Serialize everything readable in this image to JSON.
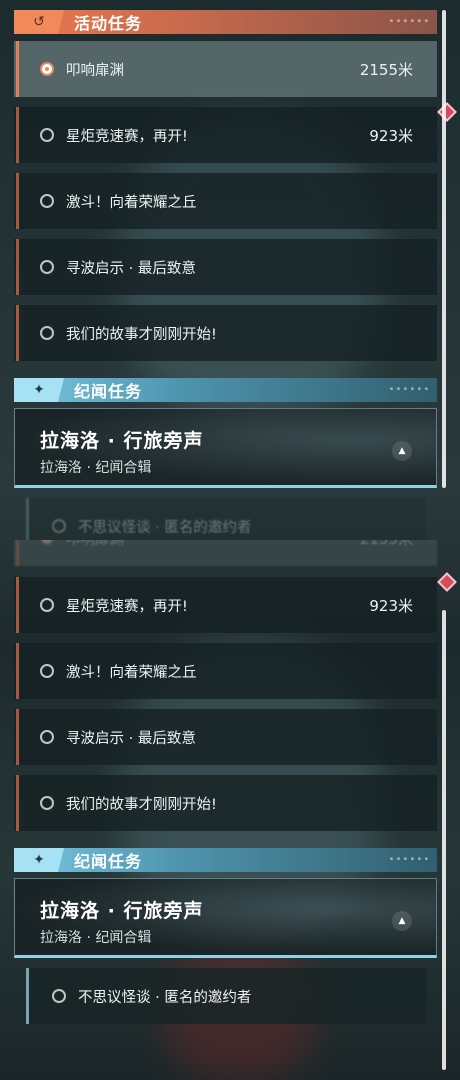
{
  "active_section": {
    "title": "活动任务",
    "badge_icon": "refresh-arrow-icon",
    "tasks": [
      {
        "label": "叩响扉渊",
        "distance": "2155米",
        "active": true
      },
      {
        "label": "星炬竞速赛，再开!",
        "distance": "923米",
        "marker": "red-diamond-icon"
      },
      {
        "label": "激斗！向着荣耀之丘",
        "distance": ""
      },
      {
        "label": "寻波启示 · 最后致意",
        "distance": ""
      },
      {
        "label": "我们的故事才刚刚开始!",
        "distance": ""
      }
    ]
  },
  "chronicle_section": {
    "title": "纪闻任务",
    "badge_icon": "four-point-star-icon",
    "card": {
      "title": "拉海洛 · 行旅旁声",
      "subtitle": "拉海洛 · 纪闻合辑",
      "toggle_icon": "triangle-up-icon"
    },
    "subtasks": [
      {
        "label": "不思议怪谈 · 匿名的邀约者"
      }
    ]
  },
  "colors": {
    "orange_accent": "#e8794d",
    "cyan_accent": "#79c7e0",
    "marker_red": "#d94a5a"
  }
}
